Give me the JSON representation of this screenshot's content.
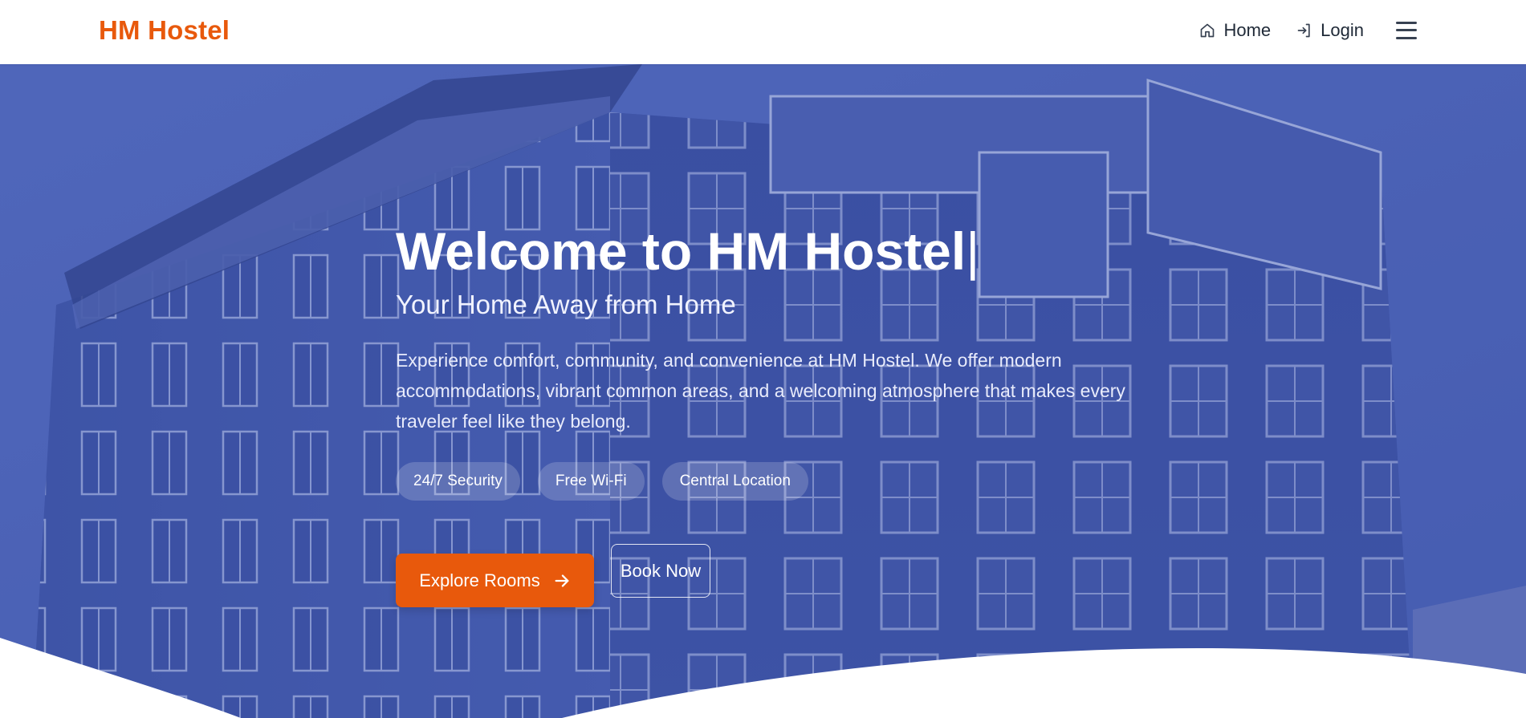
{
  "nav": {
    "brand": "HM Hostel",
    "home_label": "Home",
    "login_label": "Login",
    "menu_icon": "hamburger-menu-icon"
  },
  "hero": {
    "title": "Welcome to HM Hostel",
    "caret": "|",
    "subtitle": "Your Home Away from Home",
    "description": "Experience comfort, community, and convenience at HM Hostel. We offer modern accommodations, vibrant common areas, and a welcoming atmosphere that makes every traveler feel like they belong.",
    "tags": [
      "24/7 Security",
      "Free Wi-Fi",
      "Central Location"
    ],
    "primary_button": "Explore Rooms",
    "secondary_button": "Book Now"
  },
  "colors": {
    "brand_orange": "#e8590c",
    "hero_overlay": "#4a5fb0",
    "nav_text": "#1f2937"
  }
}
